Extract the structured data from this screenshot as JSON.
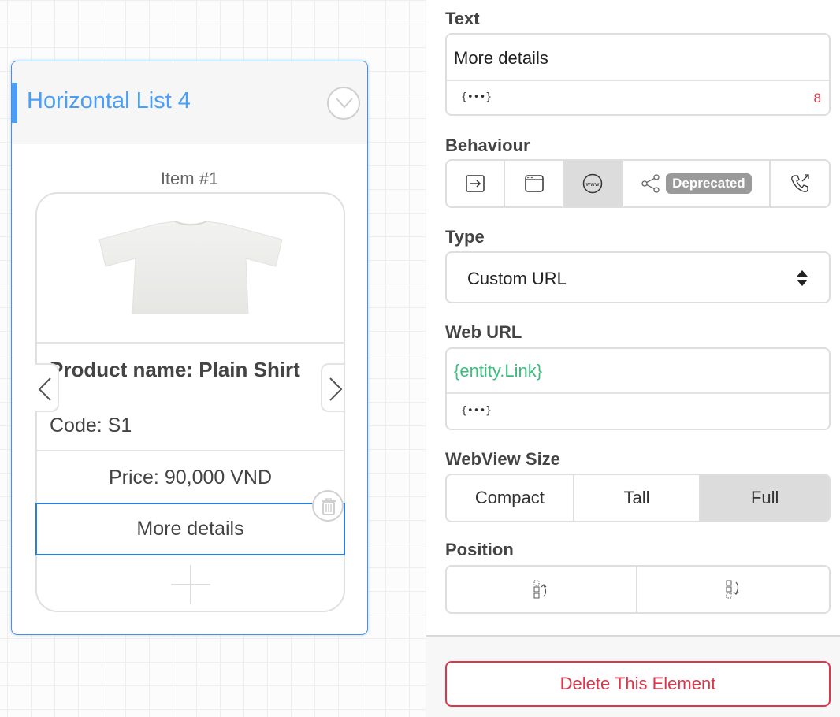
{
  "canvas": {
    "card": {
      "title": "Horizontal List 4",
      "item_label": "Item #1",
      "product_name": "Product name: Plain Shirt",
      "code": "Code: S1",
      "price": "Price: 90,000 VND",
      "button_label": "More details"
    }
  },
  "panel": {
    "text_section": {
      "label": "Text",
      "value": "More details",
      "variable_icon": "{•••}",
      "counter": "8"
    },
    "behaviour": {
      "label": "Behaviour",
      "options": [
        "block-icon",
        "window-icon",
        "web-icon",
        "share-icon",
        "phone-icon"
      ],
      "active": "web-icon",
      "deprecated_badge": "Deprecated"
    },
    "type": {
      "label": "Type",
      "value": "Custom URL"
    },
    "web_url": {
      "label": "Web URL",
      "value": "{entity.Link}",
      "variable_icon": "{•••}",
      "value_color": "#3dbd7d"
    },
    "webview_size": {
      "label": "WebView Size",
      "options": [
        "Compact",
        "Tall",
        "Full"
      ],
      "selected": "Full"
    },
    "position": {
      "label": "Position",
      "options": [
        "move-up-icon",
        "move-down-icon"
      ]
    },
    "delete_label": "Delete This Element"
  },
  "colors": {
    "accent": "#4a9ff5",
    "danger": "#e0344a",
    "selection": "#2a7fd8"
  }
}
